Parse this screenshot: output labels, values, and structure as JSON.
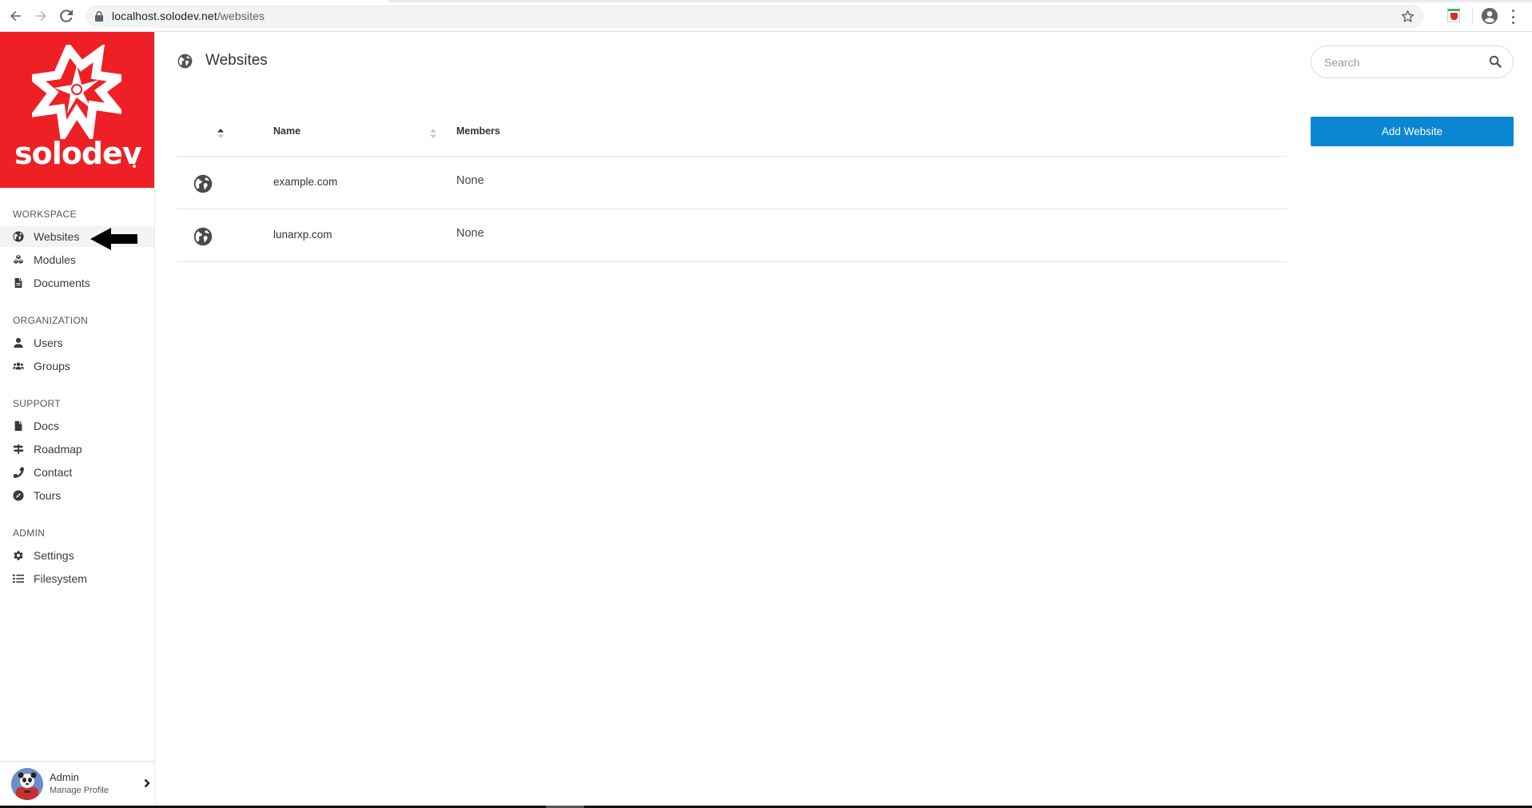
{
  "browser": {
    "url_host": "localhost.solodev.net",
    "url_path": "/websites",
    "icons": {
      "back": "arrow-left-icon",
      "forward": "arrow-right-icon",
      "reload": "reload-icon",
      "lock": "lock-icon",
      "bookmark": "star-icon",
      "extension": "shield-extension-icon",
      "profile": "account-circle-icon",
      "menu": "kebab-menu-icon"
    }
  },
  "brand": {
    "name": "solodev",
    "color": "#ee2025"
  },
  "sidebar": {
    "sections": [
      {
        "title": "WORKSPACE",
        "items": [
          {
            "label": "Websites",
            "icon": "globe-icon",
            "active": true
          },
          {
            "label": "Modules",
            "icon": "cubes-icon",
            "active": false
          },
          {
            "label": "Documents",
            "icon": "file-alt-icon",
            "active": false
          }
        ]
      },
      {
        "title": "ORGANIZATION",
        "items": [
          {
            "label": "Users",
            "icon": "user-icon",
            "active": false
          },
          {
            "label": "Groups",
            "icon": "users-icon",
            "active": false
          }
        ]
      },
      {
        "title": "SUPPORT",
        "items": [
          {
            "label": "Docs",
            "icon": "file-icon",
            "active": false
          },
          {
            "label": "Roadmap",
            "icon": "signs-icon",
            "active": false
          },
          {
            "label": "Contact",
            "icon": "phone-icon",
            "active": false
          },
          {
            "label": "Tours",
            "icon": "compass-icon",
            "active": false
          }
        ]
      },
      {
        "title": "ADMIN",
        "items": [
          {
            "label": "Settings",
            "icon": "gear-icon",
            "active": false
          },
          {
            "label": "Filesystem",
            "icon": "list-icon",
            "active": false
          }
        ]
      }
    ],
    "profile": {
      "name": "Admin",
      "subtitle": "Manage Profile"
    }
  },
  "main": {
    "title": "Websites",
    "title_icon": "globe-icon",
    "search": {
      "placeholder": "Search",
      "value": ""
    },
    "add_button_label": "Add Website",
    "accent_color": "#0a86d2",
    "table": {
      "columns": [
        "",
        "Name",
        "Members"
      ],
      "rows": [
        {
          "icon": "globe-icon",
          "name": "example.com",
          "members": "None"
        },
        {
          "icon": "globe-icon",
          "name": "lunarxp.com",
          "members": "None"
        }
      ]
    }
  }
}
